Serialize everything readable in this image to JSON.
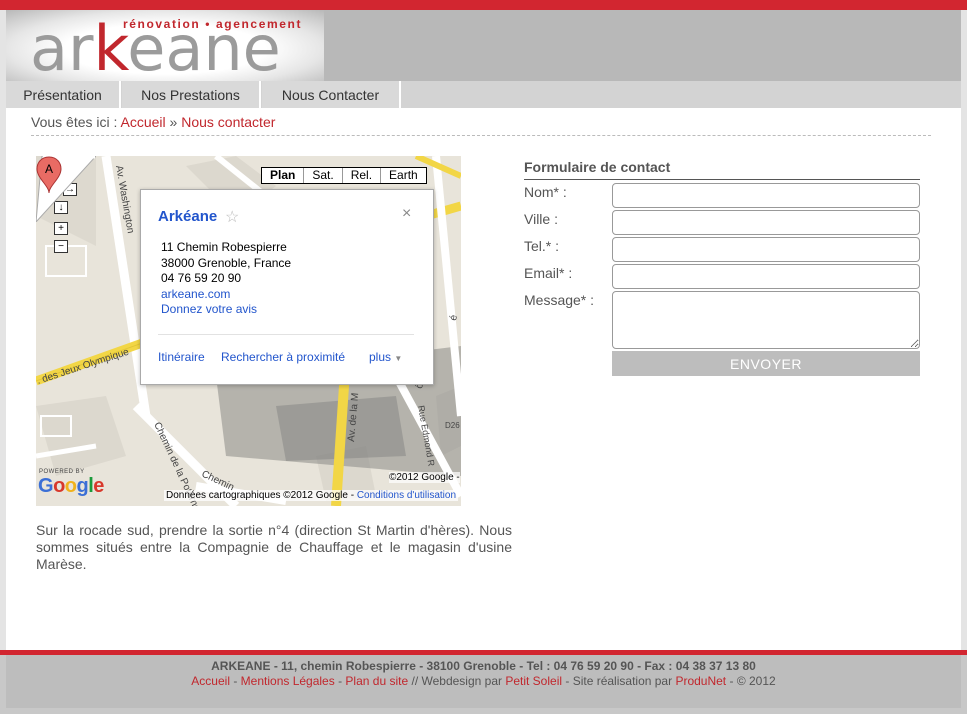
{
  "header": {
    "logo_tagline": "rénovation • agencement",
    "logo_word_pre": "ar",
    "logo_word_k": "k",
    "logo_word_post": "eane"
  },
  "nav": {
    "items": [
      {
        "label": "Présentation"
      },
      {
        "label": "Nos Prestations"
      },
      {
        "label": "Nous Contacter"
      }
    ]
  },
  "breadcrumb": {
    "prefix": "Vous êtes ici :",
    "home": "Accueil",
    "separator": "»",
    "current": "Nous contacter"
  },
  "map": {
    "controls": {
      "up": "↑",
      "left": "←",
      "right": "→",
      "down": "↓",
      "zoom_in": "+",
      "zoom_out": "−"
    },
    "types": [
      "Plan",
      "Sat.",
      "Rel.",
      "Earth"
    ],
    "active_type": "Plan",
    "streets": {
      "washington": "Av. Washington",
      "jeux": ". des Jeux Olympique",
      "poterne": "Chemin de la Poterne",
      "av_la": "Av. de la M",
      "edmond": "Rue Edmond R",
      "chemin": "Chemin",
      "d26": "D26",
      "frag_ot": "ôté",
      "frag_e": "é"
    },
    "bubble": {
      "title": "Arkéane",
      "star": "☆",
      "close": "×",
      "address1": "11 Chemin Robespierre",
      "address2": "38000 Grenoble, France",
      "phone": "04 76 59 20 90",
      "website": "arkeane.com",
      "review": "Donnez votre avis",
      "action_itinerary": "Itinéraire",
      "action_nearby": "Rechercher à proximité",
      "action_more": "plus"
    },
    "pin_label": "A",
    "powered_by": "POWERED BY",
    "google": "Google",
    "copyright_top": "©2012 Google -",
    "copyright_bottom": "Données cartographiques ©2012 Google -",
    "terms": "Conditions d'utilisation"
  },
  "directions": "Sur la rocade sud, prendre la sortie n°4 (direction St Martin d'hères). Nous sommes situés entre la Compagnie de Chauffage et le magasin d'usine Marèse.",
  "form": {
    "title": "Formulaire de contact",
    "fields": [
      {
        "label": "Nom* :",
        "value": ""
      },
      {
        "label": "Ville :",
        "value": ""
      },
      {
        "label": "Tel.* :",
        "value": ""
      },
      {
        "label": "Email* :",
        "value": ""
      },
      {
        "label": "Message* :",
        "value": ""
      }
    ],
    "submit_label": "ENVOYER"
  },
  "footer": {
    "line1": "ARKEANE - 11, chemin Robespierre - 38100 Grenoble - Tel : 04 76 59 20 90 - Fax : 04 38 37 13 80",
    "link_home": "Accueil",
    "link_legal": "Mentions Légales",
    "link_sitemap": "Plan du site",
    "webdesign_text": "// Webdesign par",
    "link_webdesign": "Petit Soleil",
    "realisation_text": "- Site réalisation par",
    "link_produnet": "ProduNet",
    "copyright": "- © 2012",
    "dash": "-"
  },
  "colors": {
    "brand_red": "#d22630",
    "link_blue": "#2255cc"
  }
}
